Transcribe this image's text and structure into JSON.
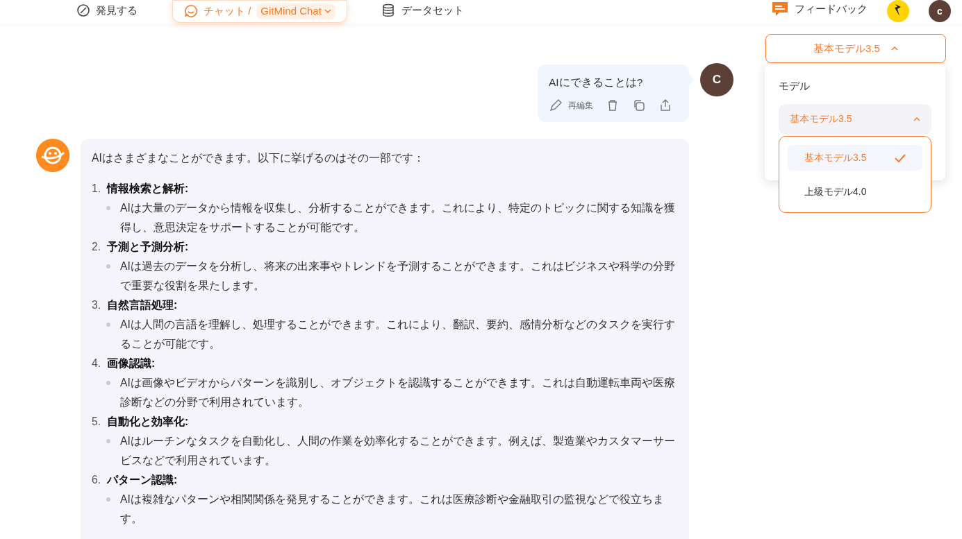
{
  "header": {
    "nav": [
      {
        "kind": "discover",
        "label": "発見する",
        "selected": false
      },
      {
        "kind": "chat",
        "label": "チャット /",
        "model": "GitMind Chat",
        "selected": true
      },
      {
        "kind": "dataset",
        "label": "データセット",
        "selected": false
      }
    ],
    "feedback": "フィードバック",
    "avatar": "c"
  },
  "model_button": {
    "label": "基本モデル3.5",
    "expanded": true
  },
  "model_panel": {
    "title": "モデル",
    "select": {
      "value": "基本モデル3.5",
      "expanded": true
    },
    "options": [
      {
        "label": "基本モデル3.5",
        "selected": true
      },
      {
        "label": "上級モデル4.0",
        "selected": false
      }
    ]
  },
  "user_message": {
    "avatar": "C",
    "text": "AIにできることは?",
    "actions": [
      {
        "kind": "edit",
        "label": "再編集"
      },
      {
        "kind": "delete"
      },
      {
        "kind": "copy"
      },
      {
        "kind": "share"
      }
    ]
  },
  "ai_message": {
    "intro": "AIはさまざまなことができます。以下に挙げるのはその一部です：",
    "items": [
      {
        "number": "1.",
        "title": "情報検索と解析:",
        "details": [
          "AIは大量のデータから情報を収集し、分析することができます。これにより、特定のトピックに関する知識を獲得し、意思決定をサポートすることが可能です。"
        ]
      },
      {
        "number": "2.",
        "title": "予測と予測分析:",
        "details": [
          "AIは過去のデータを分析し、将来の出来事やトレンドを予測することができます。これはビジネスや科学の分野で重要な役割を果たします。"
        ]
      },
      {
        "number": "3.",
        "title": "自然言語処理:",
        "details": [
          "AIは人間の言語を理解し、処理することができます。これにより、翻訳、要約、感情分析などのタスクを実行することが可能です。"
        ]
      },
      {
        "number": "4.",
        "title": "画像認識:",
        "details": [
          "AIは画像やビデオからパターンを識別し、オブジェクトを認識することができます。これは自動運転車両や医療診断などの分野で利用されています。"
        ]
      },
      {
        "number": "5.",
        "title": "自動化と効率化:",
        "details": [
          "AIはルーチンなタスクを自動化し、人間の作業を効率化することができます。例えば、製造業やカスタマーサービスなどで利用されています。"
        ]
      },
      {
        "number": "6.",
        "title": "パターン認識:",
        "details": [
          "AIは複雑なパターンや相関関係を発見することができます。これは医療診断や金融取引の監視などで役立ちます。"
        ]
      }
    ]
  }
}
